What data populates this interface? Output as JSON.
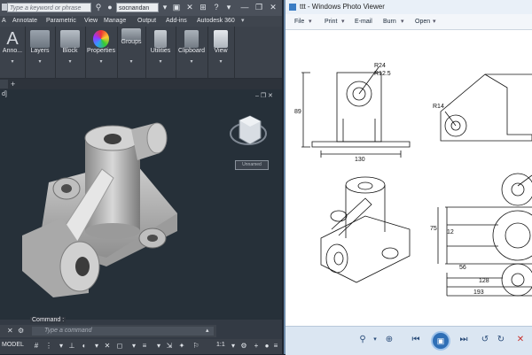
{
  "autocad": {
    "search_placeholder": "Type a keyword or phrase",
    "user_name": "socnandan",
    "menu": [
      "A",
      "Annotate",
      "Parametric",
      "View",
      "Manage",
      "Output",
      "Add-ins",
      "Autodesk 360"
    ],
    "ribbon_groups": [
      "Anno...",
      "Layers",
      "Block",
      "Properties",
      "Groups",
      "Utilities",
      "Clipboard",
      "View"
    ],
    "viewport_label": "d]",
    "viewcube_label": "Unnamed",
    "command_label": "Command :",
    "command_placeholder": "Type a command",
    "status": {
      "model": "MODEL",
      "scale": "1:1"
    }
  },
  "photo_viewer": {
    "title": "ttt - Windows Photo Viewer",
    "menu": [
      "File",
      "Print",
      "E-mail",
      "Burn",
      "Open"
    ],
    "dimensions": {
      "r24": "R24",
      "r12_5": "R12.5",
      "d89": "89",
      "d130": "130",
      "r14": "R14",
      "d75": "75",
      "d12": "12",
      "d56": "56",
      "d128": "128",
      "d193": "193"
    }
  }
}
